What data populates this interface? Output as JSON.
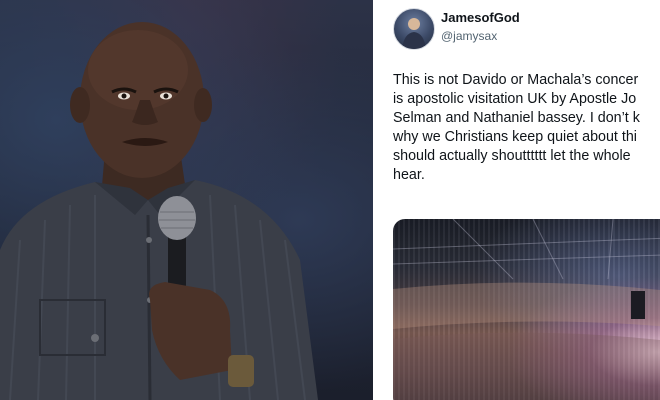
{
  "tweet": {
    "display_name": "JamesofGod",
    "handle": "@jamysax",
    "text_lines": [
      "This is not Davido or Machala’s concer",
      "is apostolic visitation UK by Apostle Jo",
      "Selman and Nathaniel bassey. I don’t k",
      "why we Christians keep quiet about thi",
      "should actually shoutttttt let the whole",
      "hear."
    ]
  },
  "icons": {
    "avatar": "profile-photo",
    "preacher_photo": "man-with-microphone-photo",
    "media": "concert-arena-crowd-photo"
  },
  "colors": {
    "text": "#0f1419",
    "secondary_text": "#536471",
    "photo_background": "#252b3d",
    "shirt": "#3a3e48"
  }
}
